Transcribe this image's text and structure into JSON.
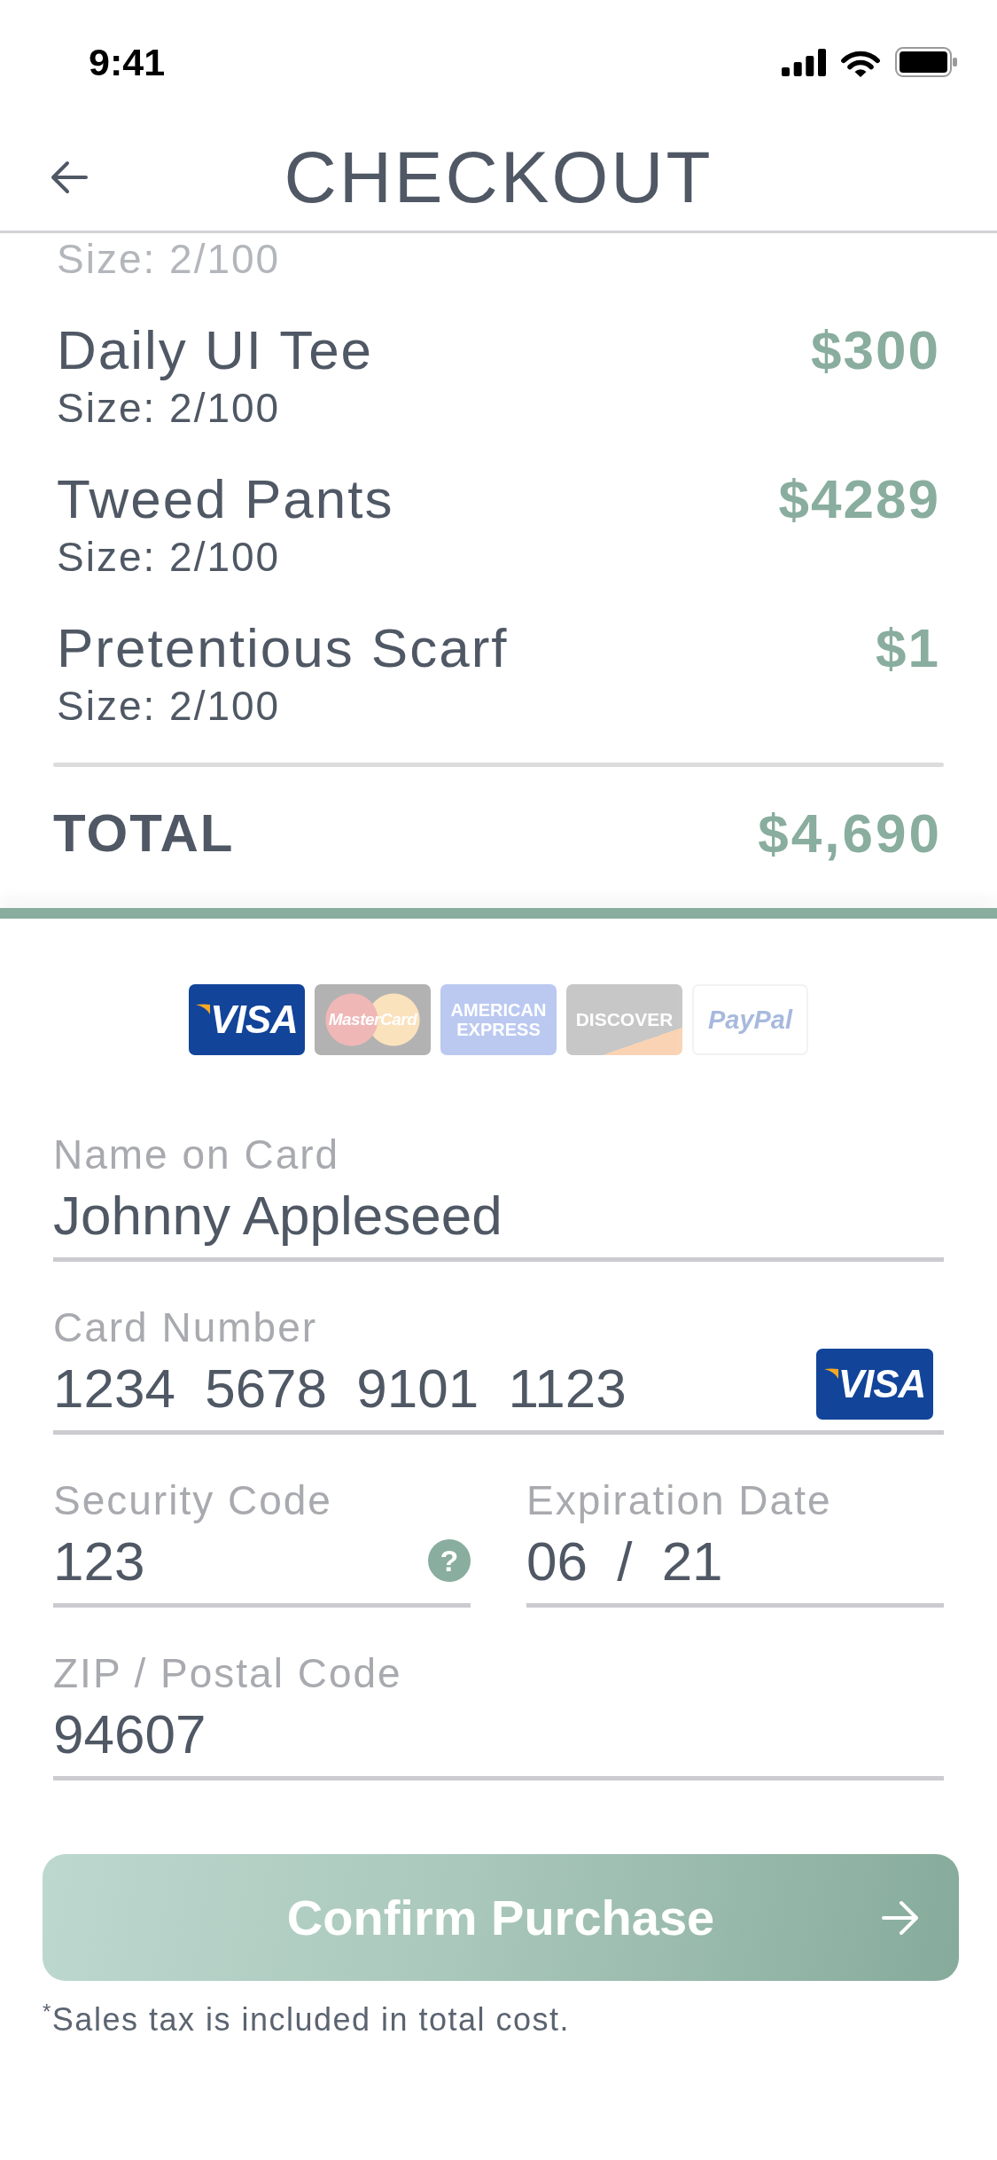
{
  "status_bar": {
    "time": "9:41"
  },
  "header": {
    "title": "CHECKOUT"
  },
  "order": {
    "scrolled_item": {
      "size": "Size: 2/100"
    },
    "items": [
      {
        "name": "Daily UI Tee",
        "size": "Size: 2/100",
        "price": "$300"
      },
      {
        "name": "Tweed Pants",
        "size": "Size: 2/100",
        "price": "$4289"
      },
      {
        "name": "Pretentious Scarf",
        "size": "Size: 2/100",
        "price": "$1"
      }
    ],
    "total": {
      "label": "TOTAL",
      "amount": "$4,690"
    }
  },
  "payment_methods": [
    {
      "kind": "visa",
      "label": "VISA",
      "selected": true
    },
    {
      "kind": "mastercard",
      "label": "MasterCard",
      "selected": false
    },
    {
      "kind": "amex",
      "label": "AMERICAN EXPRESS",
      "selected": false
    },
    {
      "kind": "discover",
      "label": "DISCOVER",
      "selected": false
    },
    {
      "kind": "paypal",
      "label": "PayPal",
      "selected": false
    }
  ],
  "form": {
    "name_on_card": {
      "label": "Name on Card",
      "value": "Johnny Appleseed"
    },
    "card_number": {
      "label": "Card Number",
      "value": "1234 5678 9101 1123",
      "brand": "VISA"
    },
    "security_code": {
      "label": "Security Code",
      "value": "123",
      "help": "?"
    },
    "expiration_date": {
      "label": "Expiration Date",
      "value": "06 / 21"
    },
    "zip": {
      "label": "ZIP / Postal Code",
      "value": "94607"
    }
  },
  "confirm_button": {
    "label": "Confirm Purchase"
  },
  "footnote": "$^{*}$Sales tax is included in total cost."
}
